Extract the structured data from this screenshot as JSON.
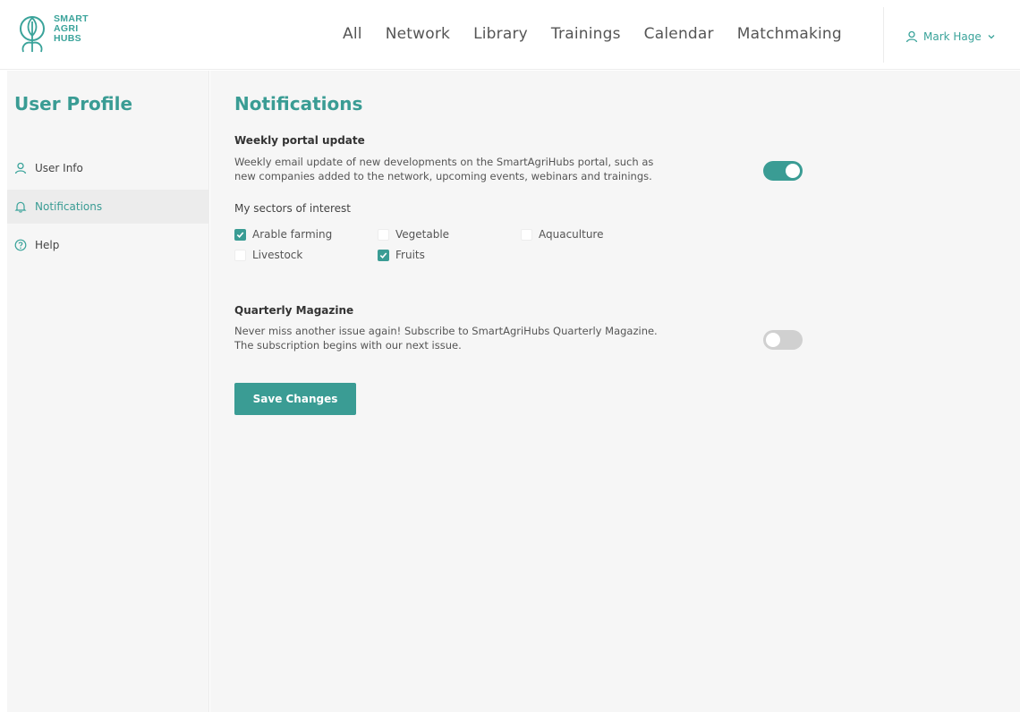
{
  "brand": {
    "logo_lines": [
      "SMART",
      "AGRI",
      "HUBS"
    ],
    "accent_color": "#3a9c94"
  },
  "topnav": {
    "items": [
      "All",
      "Network",
      "Library",
      "Trainings",
      "Calendar",
      "Matchmaking"
    ]
  },
  "user_menu": {
    "name": "Mark Hage",
    "icon": "user-icon",
    "chevron": "chevron-down-icon"
  },
  "sidebar": {
    "title": "User Profile",
    "items": [
      {
        "label": "User Info",
        "icon": "user-icon",
        "active": false
      },
      {
        "label": "Notifications",
        "icon": "bell-icon",
        "active": true
      },
      {
        "label": "Help",
        "icon": "help-circle-icon",
        "active": false
      }
    ]
  },
  "notifications": {
    "title": "Notifications",
    "weekly": {
      "title": "Weekly portal update",
      "description_line1": "Weekly email update of new developments on the SmartAgriHubs portal, such as",
      "description_line2": "new companies added to the network, upcoming events, webinars and trainings.",
      "enabled": true
    },
    "sectors": {
      "label": "My sectors of interest",
      "options": [
        {
          "label": "Arable farming",
          "checked": true
        },
        {
          "label": "Vegetable",
          "checked": false
        },
        {
          "label": "Aquaculture",
          "checked": false
        },
        {
          "label": "Livestock",
          "checked": false
        },
        {
          "label": "Fruits",
          "checked": true
        }
      ]
    },
    "quarterly": {
      "title": "Quarterly Magazine",
      "description_line1": "Never miss another issue again! Subscribe to SmartAgriHubs Quarterly Magazine.",
      "description_line2": "The subscription begins with our next issue.",
      "enabled": false
    },
    "save_label": "Save Changes"
  }
}
